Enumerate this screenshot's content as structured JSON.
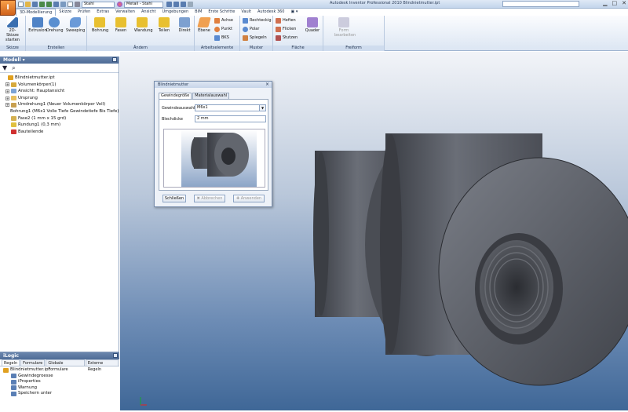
{
  "app": {
    "title": "Autodesk Inventor Professional 2010    Blindnietmutter.ipt",
    "logo_letter": "I"
  },
  "quick_access": {
    "material": "Stahl",
    "appearance": "Metall - Stahl"
  },
  "ribbon_tabs": [
    "3D-Modellierung",
    "Skizze",
    "Prüfen",
    "Extras",
    "Verwalten",
    "Ansicht",
    "Umgebungen",
    "BIM",
    "Erste Schritte",
    "Vault",
    "Autodesk 360"
  ],
  "ribbon": {
    "skizze": {
      "start_label": "2D-Skizze starten",
      "panel_label": "Skizze"
    },
    "erstellen": {
      "buttons": [
        "Extrusion",
        "Drehung",
        "Sweeping"
      ],
      "panel_label": "Erstellen"
    },
    "aendern": {
      "buttons": [
        "Bohrung",
        "Fasen",
        "Wandung",
        "Teilen",
        "Direkt"
      ],
      "panel_label": "Ändern"
    },
    "arbeitselemente": {
      "big": "Ebene",
      "small": [
        "Achse",
        "Punkt",
        "BKS"
      ],
      "panel_label": "Arbeitselemente"
    },
    "muster": {
      "small": [
        "Rechteckig",
        "Polar",
        "Spiegeln"
      ],
      "panel_label": "Muster"
    },
    "flaeche": {
      "small": [
        "Heften",
        "Flicken",
        "Stutzen"
      ],
      "big": "Quader",
      "panel_label": "Fläche"
    },
    "freiform": {
      "big": "Form bearbeiten",
      "panel_label": "Freiform"
    }
  },
  "model_panel": {
    "header": "Modell",
    "items": [
      {
        "label": "Blindnietmutter.ipt",
        "indent": 0,
        "expander": "",
        "color": "#e0a020"
      },
      {
        "label": "Volumenkörper(1)",
        "indent": 1,
        "expander": "+",
        "color": "#d6a93c"
      },
      {
        "label": "Ansicht: Hauptansicht",
        "indent": 1,
        "expander": "+",
        "color": "#7da4d6"
      },
      {
        "label": "Ursprung",
        "indent": 1,
        "expander": "+",
        "color": "#e8c060"
      },
      {
        "label": "Umdrehung1 (Neuer Volumenkörper Voll)",
        "indent": 1,
        "expander": "+",
        "color": "#c8a050"
      },
      {
        "label": "Bohrung1 (M6x1 Volle Tiefe Gewindetiefe Bis Tiefe)",
        "indent": 1,
        "expander": "",
        "color": "#c07a30"
      },
      {
        "label": "Fase2 (1 mm x 15 grd)",
        "indent": 1,
        "expander": "",
        "color": "#d4b050"
      },
      {
        "label": "Rundung1 (0,3 mm)",
        "indent": 1,
        "expander": "",
        "color": "#e0c040"
      },
      {
        "label": "Bauteilende",
        "indent": 1,
        "expander": "",
        "color": "#d03030"
      }
    ]
  },
  "ilogic": {
    "header": "iLogic",
    "tabs": [
      "Regeln",
      "Formulare",
      "Globale Formulare",
      "Externe Regeln"
    ],
    "items": [
      {
        "label": "Blindnietmutter.ipt",
        "indent": 0
      },
      {
        "label": "Gewindegroesse",
        "indent": 1
      },
      {
        "label": "iProperties",
        "indent": 1
      },
      {
        "label": "Warnung",
        "indent": 1
      },
      {
        "label": "Speichern unter",
        "indent": 1
      }
    ]
  },
  "dialog": {
    "title": "Blindnietmutter",
    "tabs": [
      "Gewindegröße",
      "Materialauswahl"
    ],
    "fields": {
      "gewinde_label": "Gewindeauswahl",
      "gewinde_value": "M6x1",
      "blech_label": "Blechdicke",
      "blech_value": "2 mm"
    },
    "buttons": {
      "close": "Schließen",
      "cancel": "Abbrechen",
      "apply": "Anwenden"
    }
  }
}
